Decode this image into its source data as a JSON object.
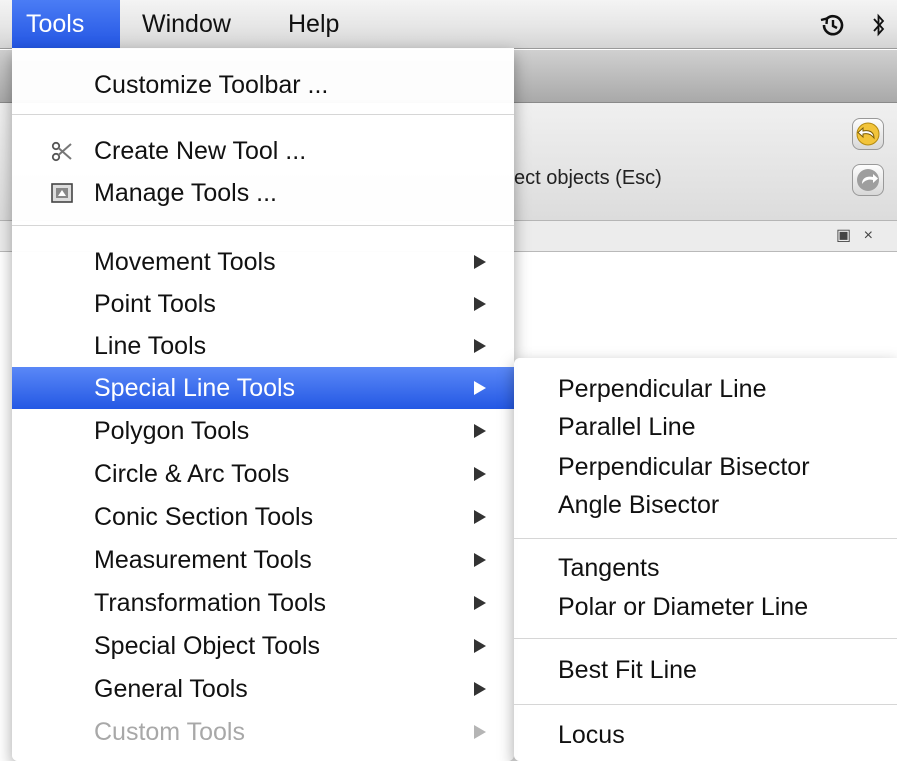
{
  "menubar": {
    "items": [
      "Tools",
      "Window",
      "Help"
    ]
  },
  "background": {
    "tool_description": "ect objects (Esc)"
  },
  "tools_menu": {
    "customize": "Customize Toolbar ...",
    "create_tool": "Create New Tool ...",
    "manage_tools": "Manage Tools ...",
    "categories": [
      "Movement Tools",
      "Point Tools",
      "Line Tools",
      "Special Line Tools",
      "Polygon Tools",
      "Circle & Arc Tools",
      "Conic Section Tools",
      "Measurement Tools",
      "Transformation Tools",
      "Special Object Tools",
      "General Tools",
      "Custom Tools"
    ],
    "selected": "Special Line Tools",
    "disabled": "Custom Tools"
  },
  "submenu": {
    "group1": [
      "Perpendicular Line",
      "Parallel Line",
      "Perpendicular Bisector",
      "Angle Bisector"
    ],
    "group2": [
      "Tangents",
      "Polar or Diameter Line"
    ],
    "group3": [
      "Best Fit Line"
    ],
    "group4": [
      "Locus"
    ]
  },
  "colors": {
    "selection": "#2f62e8",
    "disabled_text": "#a8a8a8"
  },
  "icons": [
    "time-machine-icon",
    "bluetooth-icon",
    "scissors-wrench-icon",
    "manage-tools-icon",
    "undo-icon",
    "redo-icon",
    "restore-panel-icon",
    "close-panel-icon"
  ]
}
